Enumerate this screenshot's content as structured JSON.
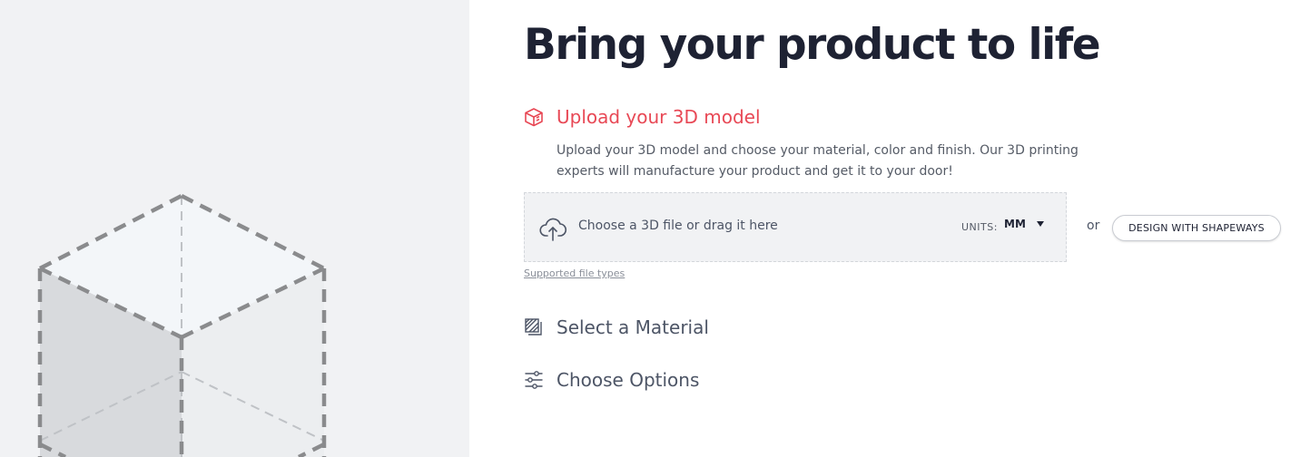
{
  "page": {
    "title": "Bring your product to life"
  },
  "steps": {
    "upload": {
      "icon": "cube-icon",
      "title": "Upload your 3D model",
      "description": "Upload your 3D model and choose your material, color and finish. Our 3D printing experts will manufacture your product and get it to your door!"
    },
    "material": {
      "icon": "material-swatch-icon",
      "title": "Select a Material"
    },
    "options": {
      "icon": "sliders-icon",
      "title": "Choose Options"
    }
  },
  "upload": {
    "icon": "cloud-upload-icon",
    "prompt": "Choose a 3D file or drag it here",
    "units_label": "UNITS:",
    "units_value": "MM",
    "supported_link": "Supported file types"
  },
  "alternative": {
    "or_text": "or",
    "design_button": "DESIGN WITH SHAPEWAYS"
  },
  "colors": {
    "accent": "#e84855",
    "heading": "#1e2233",
    "muted": "#4d5566",
    "left_panel_bg": "#f1f2f4"
  }
}
